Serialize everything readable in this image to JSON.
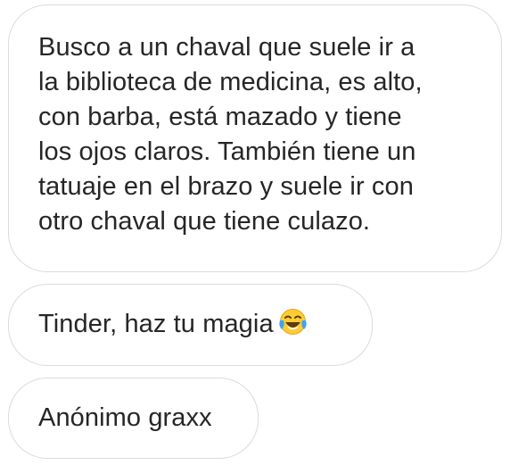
{
  "messages": [
    {
      "lines": [
        "Busco a un chaval que suele ir a",
        "la biblioteca de medicina, es alto,",
        "con barba, está mazado y tiene",
        "los ojos claros. También tiene un",
        "tatuaje en el brazo y suele ir con",
        "otro chaval que tiene culazo."
      ]
    },
    {
      "text": "Tinder, haz tu magia",
      "emoji": "face-with-tears-of-joy-icon"
    },
    {
      "text": "Anónimo graxx"
    }
  ],
  "colors": {
    "bubble_border": "#dbdbdb",
    "text": "#262626",
    "emoji_face": "#ffcc33",
    "emoji_tears": "#3ba3f5"
  }
}
